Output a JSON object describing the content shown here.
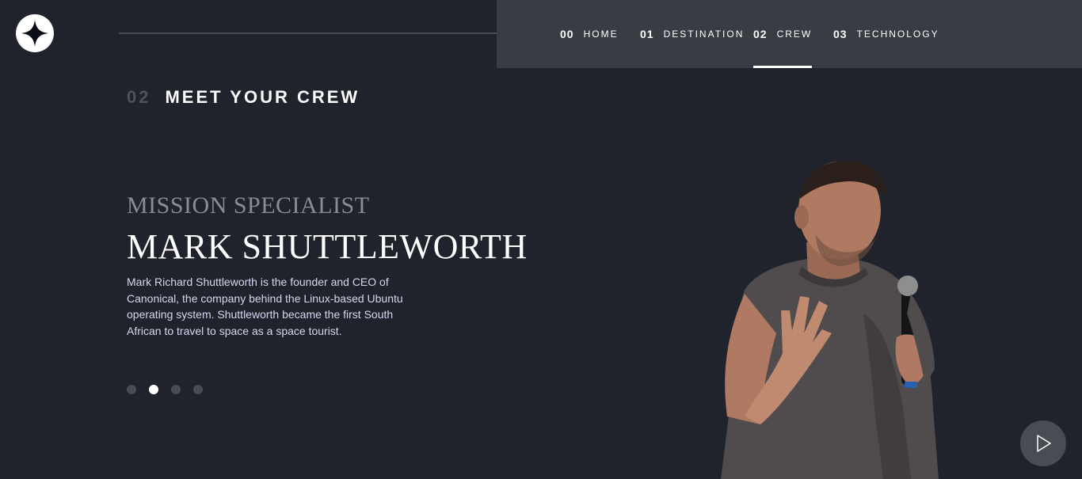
{
  "nav": {
    "items": [
      {
        "num": "00",
        "label": "HOME"
      },
      {
        "num": "01",
        "label": "DESTINATION"
      },
      {
        "num": "02",
        "label": "CREW"
      },
      {
        "num": "03",
        "label": "TECHNOLOGY"
      }
    ],
    "active_index": 2
  },
  "page_heading": {
    "num": "02",
    "title": "MEET YOUR CREW"
  },
  "crew": {
    "role": "MISSION SPECIALIST",
    "name": "MARK SHUTTLEWORTH",
    "bio": "Mark Richard Shuttleworth is the founder and CEO of Canonical, the company behind the Linux-based Ubuntu operating system. Shuttleworth became the first South African to travel to space as a space tourist."
  },
  "pagination": {
    "count": 4,
    "active_index": 1
  },
  "icons": {
    "logo": "star-logo-icon",
    "play": "play-icon"
  },
  "colors": {
    "background": "#20232b",
    "nav_background": "#3a3c44",
    "accent_text": "#d3d8f0",
    "muted": "#8b8d93"
  }
}
